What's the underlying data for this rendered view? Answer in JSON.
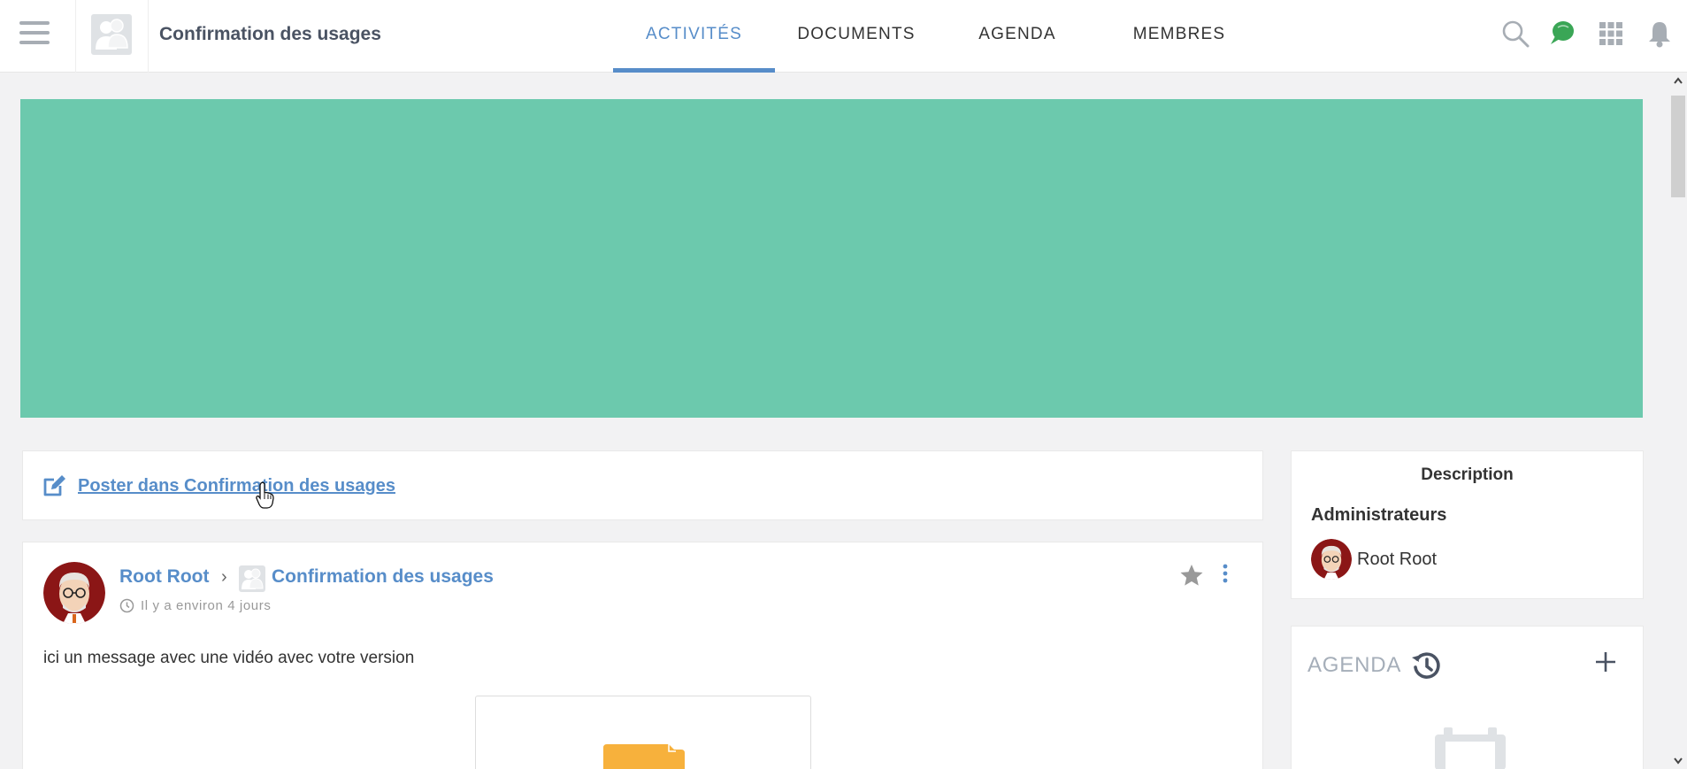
{
  "header": {
    "menu_icon": "hamburger-icon",
    "space_title": "Confirmation des usages",
    "tabs": [
      {
        "label": "ACTIVITÉS",
        "active": true
      },
      {
        "label": "DOCUMENTS",
        "active": false
      },
      {
        "label": "AGENDA",
        "active": false
      },
      {
        "label": "MEMBRES",
        "active": false
      }
    ],
    "icons": [
      "search-icon",
      "chat-icon",
      "apps-grid-icon",
      "bell-icon"
    ],
    "accent_color": "#578dc9"
  },
  "banner": {
    "color": "#6cc9ad"
  },
  "composer": {
    "label": "Poster dans Confirmation des usages",
    "icon": "edit-icon"
  },
  "post": {
    "author": "Root Root",
    "space": "Confirmation des usages",
    "time": "Il y a environ 4 jours",
    "body": "ici un message avec une vidéo avec votre version"
  },
  "sidebar": {
    "description_title": "Description",
    "admins_title": "Administrateurs",
    "admins": [
      {
        "name": "Root Root"
      }
    ],
    "agenda_title": "AGENDA"
  }
}
